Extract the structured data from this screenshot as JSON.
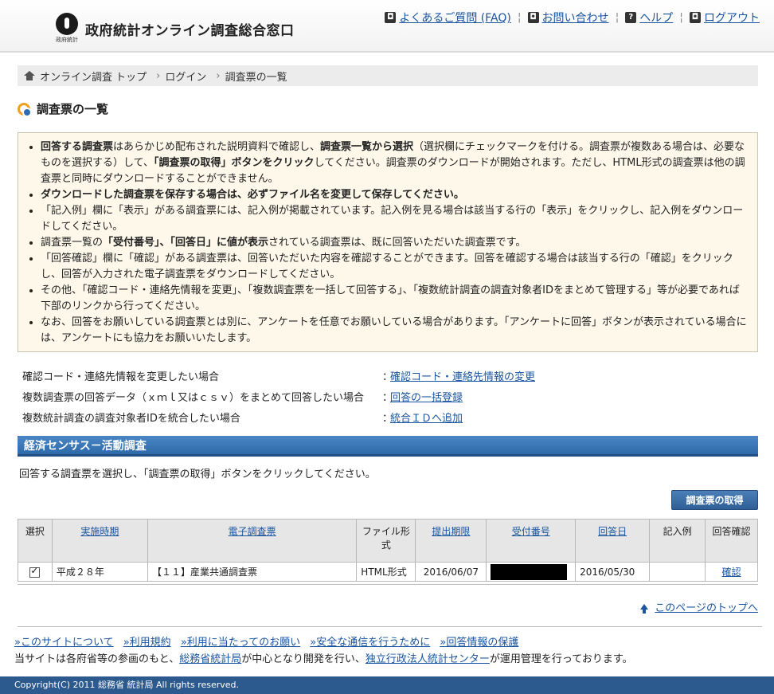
{
  "header": {
    "logo_caption": "政府統計",
    "site_title": "政府統計オンライン調査総合窓口",
    "nav": [
      {
        "icon": "faq-icon",
        "label": "よくあるご質問 (FAQ)"
      },
      {
        "icon": "contact-icon",
        "label": "お問い合わせ"
      },
      {
        "icon": "help-icon",
        "label": "ヘルプ",
        "glyph": "?"
      },
      {
        "icon": "logout-icon",
        "label": "ログアウト"
      }
    ]
  },
  "breadcrumb": [
    "オンライン調査 トップ",
    "ログイン",
    "調査票の一覧"
  ],
  "page_title": "調査票の一覧",
  "notice": [
    "回答する調査票はあらかじめ配布された説明資料で確認し、調査票一覧から選択（選択欄にチェックマークを付ける。調査票が複数ある場合は、必要なものを選択する）して、「調査票の取得」ボタンをクリックしてください。調査票のダウンロードが開始されます。ただし、HTML形式の調査票は他の調査票と同時にダウンロードすることができません。",
    "ダウンロードした調査票を保存する場合は、必ずファイル名を変更して保存してください。",
    "「記入例」欄に「表示」がある調査票には、記入例が掲載されています。記入例を見る場合は該当する行の「表示」をクリックし、記入例をダウンロードしてください。",
    "調査票一覧の「受付番号」、「回答日」に値が表示されている調査票は、既に回答いただいた調査票です。",
    "「回答確認」欄に「確認」がある調査票は、回答いただいた内容を確認することができます。回答を確認する場合は該当する行の「確認」をクリックし、回答が入力された電子調査票をダウンロードしてください。",
    "その他、「確認コード・連絡先情報を変更」、「複数調査票を一括して回答する」、「複数統計調査の調査対象者IDをまとめて管理する」等が必要であれば下部のリンクから行ってください。",
    "なお、回答をお願いしている調査票とは別に、アンケートを任意でお願いしている場合があります。「アンケートに回答」ボタンが表示されている場合には、アンケートにも協力をお願いいたします。"
  ],
  "links": [
    {
      "label": "確認コード・連絡先情報を変更したい場合",
      "link": "確認コード・連絡先情報の変更"
    },
    {
      "label": "複数調査票の回答データ（ｘｍｌ又はｃｓｖ）をまとめて回答したい場合",
      "link": "回答の一括登録"
    },
    {
      "label": "複数統計調査の調査対象者IDを統合したい場合",
      "link": "統合ＩＤへ追加"
    }
  ],
  "section": {
    "title": "経済センサス－活動調査",
    "instruction": "回答する調査票を選択し、「調査票の取得」ボタンをクリックしてください。",
    "fetch_button": "調査票の取得"
  },
  "table": {
    "headers": [
      "選択",
      "実施時期",
      "電子調査票",
      "ファイル形式",
      "提出期限",
      "受付番号",
      "回答日",
      "記入例",
      "回答確認"
    ],
    "rows": [
      {
        "selected": true,
        "period": "平成２８年",
        "form": "【１１】産業共通調査票",
        "format": "HTML形式",
        "deadline": "2016/06/07",
        "receipt": "",
        "answered": "2016/05/30",
        "example": "",
        "confirm": "確認"
      }
    ]
  },
  "page_top": "このページのトップへ",
  "footer": {
    "links": [
      "»このサイトについて",
      "»利用規約",
      "»利用に当たってのお願い",
      "»安全な通信を行うために",
      "»回答情報の保護"
    ],
    "text_1": "当サイトは各府省等の参画のもと、",
    "org_1": "総務省統計局",
    "text_2": "が中心となり開発を行い、",
    "org_2": "独立行政法人統計センター",
    "text_3": "が運用管理を行っております。",
    "copyright": "Copyright(C) 2011 総務省 統計局 All rights reserved."
  }
}
